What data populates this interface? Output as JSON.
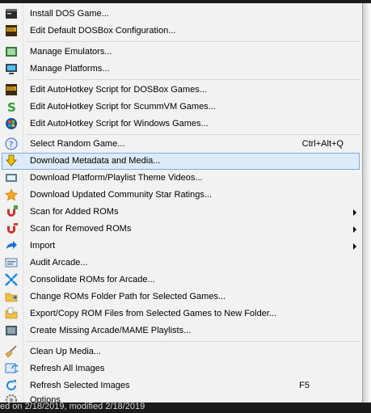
{
  "menu": {
    "items": [
      {
        "label": "Install DOS Game...",
        "icon": "dos-terminal-icon"
      },
      {
        "label": "Edit Default DOSBox Configuration...",
        "icon": "dosbox-icon"
      },
      {
        "label": "Manage Emulators...",
        "icon": "emulator-icon"
      },
      {
        "label": "Manage Platforms...",
        "icon": "platform-icon"
      },
      {
        "label": "Edit AutoHotkey Script for DOSBox Games...",
        "icon": "dosbox-icon"
      },
      {
        "label": "Edit AutoHotkey Script for ScummVM Games...",
        "icon": "scummvm-icon"
      },
      {
        "label": "Edit AutoHotkey Script for Windows Games...",
        "icon": "windows-icon"
      },
      {
        "label": "Select Random Game...",
        "icon": "random-icon",
        "shortcut": "Ctrl+Alt+Q"
      },
      {
        "label": "Download Metadata and Media...",
        "icon": "download-arrow-icon"
      },
      {
        "label": "Download Platform/Playlist Theme Videos...",
        "icon": "video-icon"
      },
      {
        "label": "Download Updated Community Star Ratings...",
        "icon": "star-icon"
      },
      {
        "label": "Scan for Added ROMs",
        "icon": "magnet-add-icon"
      },
      {
        "label": "Scan for Removed ROMs",
        "icon": "magnet-remove-icon"
      },
      {
        "label": "Import",
        "icon": "import-arrow-icon"
      },
      {
        "label": "Audit Arcade...",
        "icon": "audit-icon"
      },
      {
        "label": "Consolidate ROMs for Arcade...",
        "icon": "consolidate-icon"
      },
      {
        "label": "Change ROMs Folder Path for Selected Games...",
        "icon": "folder-path-icon"
      },
      {
        "label": "Export/Copy ROM Files from Selected Games to New Folder...",
        "icon": "export-folder-icon"
      },
      {
        "label": "Create Missing Arcade/MAME Playlists...",
        "icon": "playlist-icon"
      },
      {
        "label": "Clean Up Media...",
        "icon": "broom-icon"
      },
      {
        "label": "Refresh All Images",
        "icon": "refresh-all-icon"
      },
      {
        "label": "Refresh Selected Images",
        "icon": "refresh-selected-icon",
        "shortcut": "F5"
      },
      {
        "label": "Options",
        "icon": "gear-icon"
      }
    ]
  },
  "background_text": "ed on 2/18/2019, modified 2/18/2019",
  "colors": {
    "highlight_bg": "#dcebf7",
    "highlight_border": "#78aee5",
    "menu_bg": "#f2f2f2"
  }
}
